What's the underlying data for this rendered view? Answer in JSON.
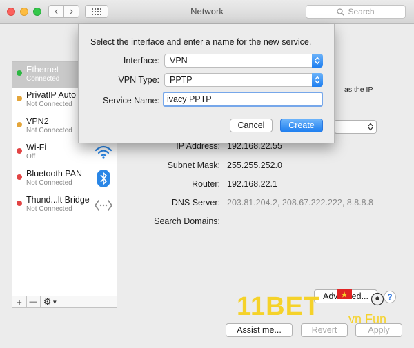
{
  "window": {
    "title": "Network",
    "search_placeholder": "Search",
    "nav_back": "‹",
    "nav_forward": "›"
  },
  "services": [
    {
      "name": "Ethernet",
      "status": "Connected",
      "status_color": "#2cb742",
      "selected": true,
      "icon": ""
    },
    {
      "name": "PrivatIP Auto",
      "status": "Not Connected",
      "status_color": "#e4a53a",
      "icon": ""
    },
    {
      "name": "VPN2",
      "status": "Not Connected",
      "status_color": "#e4a53a",
      "icon": ""
    },
    {
      "name": "Wi-Fi",
      "status": "Off",
      "status_color": "#e24444",
      "icon": "wifi-icon"
    },
    {
      "name": "Bluetooth PAN",
      "status": "Not Connected",
      "status_color": "#e24444",
      "icon": "bluetooth-icon"
    },
    {
      "name": "Thund...lt Bridge",
      "status": "Not Connected",
      "status_color": "#e24444",
      "icon": "thunderbolt-bridge-icon"
    }
  ],
  "sidebar_tools": {
    "add": "+",
    "remove": "—",
    "gear": "⚙"
  },
  "details": {
    "partial_text": "as the IP",
    "ip_address_label": "IP Address:",
    "ip_address": "192.168.22.55",
    "subnet_label": "Subnet Mask:",
    "subnet": "255.255.252.0",
    "router_label": "Router:",
    "router": "192.168.22.1",
    "dns_label": "DNS Server:",
    "dns": "203.81.204.2, 208.67.222.222, 8.8.8.8",
    "search_domains_label": "Search Domains:"
  },
  "buttons": {
    "advanced": "Advanced...",
    "help": "?",
    "assist": "Assist me...",
    "revert": "Revert",
    "apply": "Apply"
  },
  "sheet": {
    "prompt": "Select the interface and enter a name for the new service.",
    "interface_label": "Interface:",
    "interface_value": "VPN",
    "vpn_type_label": "VPN Type:",
    "vpn_type_value": "PPTP",
    "service_name_label": "Service Name:",
    "service_name_value": "ivacy PPTP",
    "cancel": "Cancel",
    "create": "Create"
  },
  "watermark": {
    "brand": "11BET",
    "suffix": "vn Fun"
  },
  "colors": {
    "accent": "#1f7ff0",
    "selection": "#c9c9c9",
    "watermark": "#f5d22a"
  }
}
